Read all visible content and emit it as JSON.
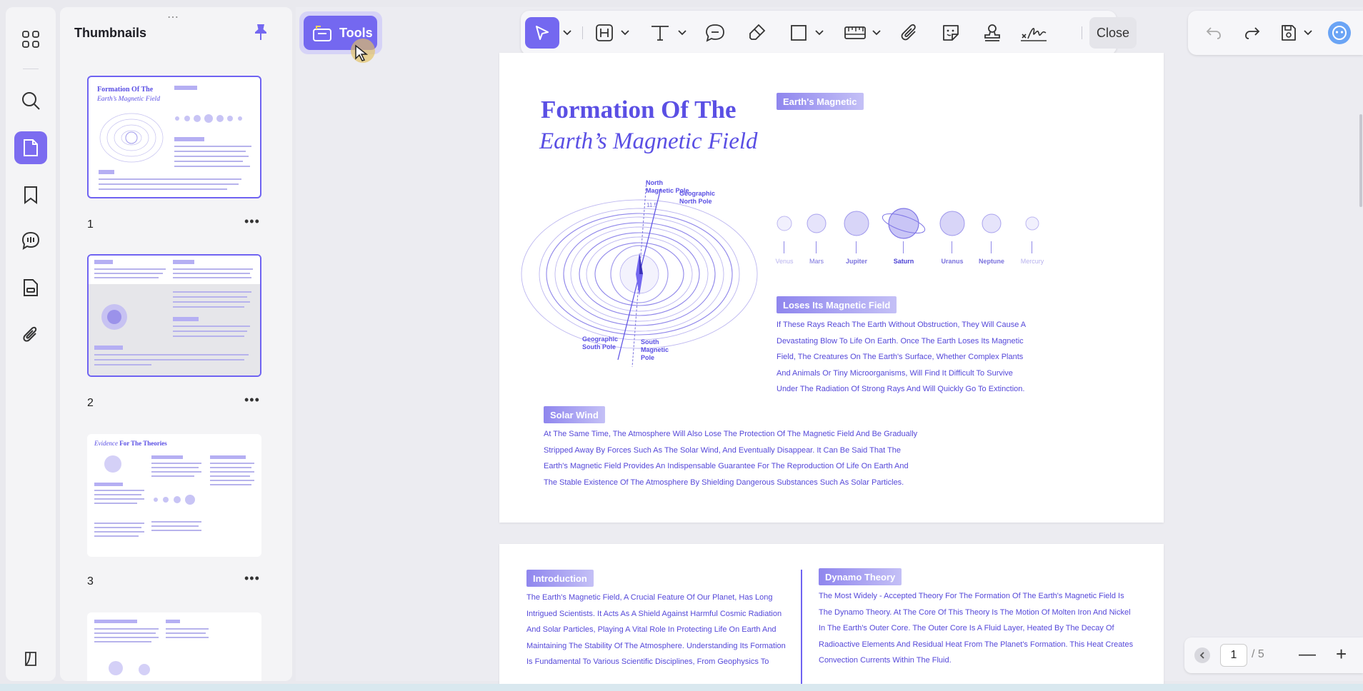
{
  "sidebar": {
    "thumbnails_title": "Thumbnails",
    "pages": [
      {
        "number": "1"
      },
      {
        "number": "2"
      },
      {
        "number": "3"
      }
    ]
  },
  "toolbar": {
    "tools_label": "Tools",
    "close_label": "Close"
  },
  "document": {
    "title_line1": "Formation Of The",
    "title_line2": "Earth’s Magnetic Field",
    "diagram": {
      "north_magnetic_pole": "North Magnetic Pole",
      "geographic_north_pole": "Geographic North Pole",
      "geographic_south_pole": "Geographic South Pole",
      "south_magnetic_pole": "South Magnetic Pole",
      "angle": "11.5"
    },
    "earths_magnetic_tag": "Earth's Magnetic",
    "planets": [
      "Venus",
      "Mars",
      "Jupiter",
      "Saturn",
      "Uranus",
      "Neptune",
      "Mercury"
    ],
    "loses_tag": "Loses Its Magnetic Field",
    "loses_lines": [
      "If These Rays Reach The Earth Without Obstruction, They Will Cause A",
      "Devastating Blow To Life On Earth. Once The Earth Loses Its Magnetic",
      "Field, The Creatures On The Earth's Surface, Whether Complex Plants",
      "And Animals Or Tiny Microorganisms, Will Find It Difficult To Survive",
      "Under The Radiation Of Strong Rays And Will Quickly Go To Extinction."
    ],
    "solar_tag": "Solar Wind",
    "solar_lines": [
      "At The Same Time, The Atmosphere Will Also Lose The Protection Of The Magnetic Field And Be Gradually",
      "Stripped Away By Forces Such As The Solar Wind, And Eventually Disappear. It Can Be Said That The",
      "Earth's Magnetic Field Provides An Indispensable Guarantee For The Reproduction Of Life On Earth And",
      "The Stable Existence Of The Atmosphere By Shielding Dangerous Substances Such As Solar Particles."
    ],
    "intro_tag": "Introduction",
    "intro_lines": [
      "The Earth's Magnetic Field, A Crucial Feature Of Our Planet, Has Long",
      "Intrigued Scientists. It Acts As A Shield Against Harmful Cosmic Radiation",
      "And Solar Particles, Playing A Vital Role In Protecting Life On Earth And",
      "Maintaining The Stability Of The Atmosphere. Understanding Its Formation",
      "Is Fundamental To Various Scientific Disciplines, From Geophysics To"
    ],
    "dynamo_tag": "Dynamo Theory",
    "dynamo_lines": [
      "The Most Widely - Accepted Theory For The Formation Of The Earth's Magnetic Field Is",
      "The Dynamo Theory. At The Core Of This Theory Is The Motion Of Molten Iron And Nickel",
      "In The Earth's Outer Core. The Outer Core Is A Fluid Layer, Heated By The Decay Of",
      "Radioactive Elements And Residual Heat From The Planet's Formation. This Heat Creates",
      "Convection Currents Within The Fluid."
    ]
  },
  "thumbnail3": {
    "title_italic": "Evidence",
    "title_rest": " For The Theories"
  },
  "pager": {
    "current_page": "1",
    "total": "/ 5"
  },
  "colors": {
    "accent": "#7468f0",
    "doc_text": "#5548d9"
  }
}
